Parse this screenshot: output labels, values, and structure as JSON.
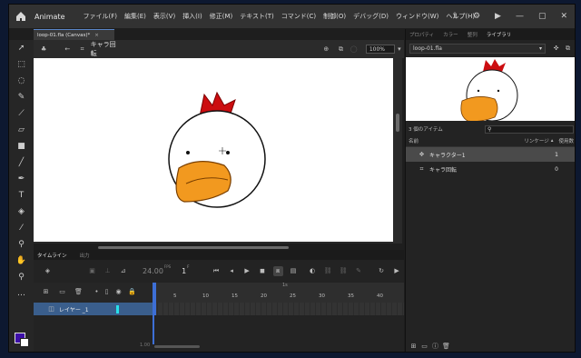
{
  "app": {
    "name": "Animate",
    "colors": {
      "accent": "#2d88ff",
      "stage_bg": "#ffffff",
      "selection": "#3a5e8c",
      "playhead": "#3d6fd6"
    }
  },
  "menu": [
    "ファイル(F)",
    "編集(E)",
    "表示(V)",
    "挿入(I)",
    "修正(M)",
    "テキスト(T)",
    "コマンド(C)",
    "制御(O)",
    "デバッグ(D)",
    "ウィンドウ(W)",
    "ヘルプ(H)"
  ],
  "document": {
    "tab_label": "loop-01.fla (Canvas)*",
    "scene_label": "キャラ回転",
    "zoom": "100%"
  },
  "timeline": {
    "tabs": [
      "タイムライン",
      "出力"
    ],
    "fps": "24.00",
    "fps_unit": "FPS",
    "frame": "1",
    "frame_unit": "F",
    "ruler_marks": [
      "5",
      "10",
      "15",
      "20",
      "25",
      "30",
      "35",
      "40"
    ],
    "ruler_top_mark": "1s",
    "layer_name": "レイヤー _1",
    "time_display": "1.00"
  },
  "right_panel": {
    "tabs": [
      "プロパティ",
      "カラー",
      "整列",
      "ライブラリ"
    ],
    "active_tab": "ライブラリ",
    "file_select": "loop-01.fla",
    "item_count": "3 個のアイテム",
    "search_placeholder": "",
    "columns": {
      "name": "名前",
      "linkage": "リンケージ",
      "usage": "使用数"
    },
    "items": [
      {
        "name": "キャラクター1",
        "usage": "1"
      },
      {
        "name": "キャラ回転",
        "usage": "0"
      }
    ]
  }
}
